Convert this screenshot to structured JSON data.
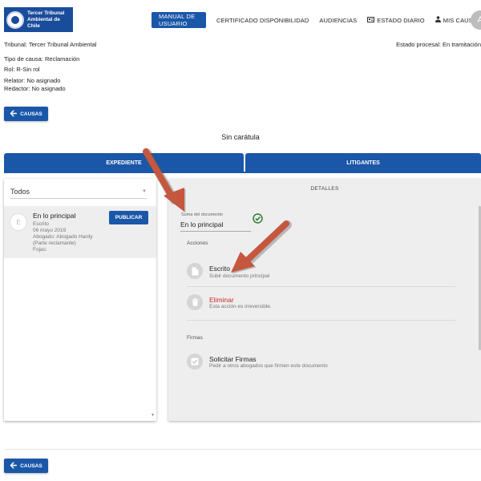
{
  "logo": {
    "line1": "Tercer Tribunal",
    "line2": "Ambiental de Chile"
  },
  "nav": {
    "manual": "MANUAL DE USUARIO",
    "certificado": "CERTIFICADO DISPONIBILIDAD",
    "audiencias": "AUDIENCIAS",
    "estado_diario": "ESTADO DIARIO",
    "mis_causas": "MIS CAUSAS",
    "avatar_initial": "A"
  },
  "info": {
    "tribunal": "Tribunal: Tercer Tribunal Ambiental",
    "estado": "Estado procesal: En tramitación",
    "tipo": "Tipo de causa: Reclamación",
    "rol": "Rol: R-Sin rol",
    "relator": "Relator: No asignado",
    "redactor": "Redactor: No asignado"
  },
  "buttons": {
    "causas": "CAUSAS",
    "publicar": "PUBLICAR"
  },
  "caratula": "Sin carátula",
  "tabs": {
    "expediente": "EXPEDIENTE",
    "litigantes": "LITIGANTES"
  },
  "filter": {
    "selected": "Todos"
  },
  "document_item": {
    "title": "En lo principal",
    "type": "Escrito",
    "date": "06 mayo 2019",
    "author": "Abogado: Abogado Hardy",
    "role": "(Parte reclamante)",
    "fojas": "Fojas:"
  },
  "details": {
    "header": "DETALLES",
    "field_label": "Suma del documento",
    "field_value": "En lo principal",
    "acciones": "Acciones",
    "escrito_title": "Escrito",
    "escrito_sub": "Subir documento principal",
    "eliminar_title": "Eliminar",
    "eliminar_sub": "Esta acción es irreversible.",
    "firmas": "Firmas",
    "solicitar_title": "Solicitar Firmas",
    "solicitar_sub": "Pedir a otros abogados que firmen este documento"
  },
  "colors": {
    "primary": "#1a57a8",
    "danger": "#c62828",
    "success": "#2e7d32",
    "annotation": "#c5573f"
  },
  "icons": [
    "back-arrow-icon",
    "newspaper-icon",
    "person-icon",
    "document-icon",
    "trash-icon",
    "checkbox-icon",
    "check-circle-icon",
    "chevron-down-icon"
  ]
}
